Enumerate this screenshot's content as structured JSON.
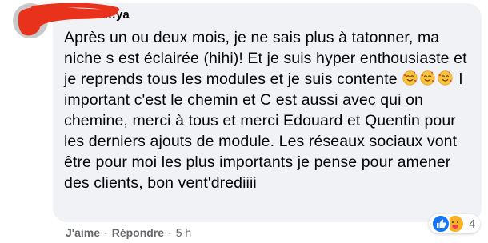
{
  "comment": {
    "author": "…ya",
    "text_before_emoji": "Après un ou deux mois, je ne sais plus à tatonner, ma niche s est éclairée (hihi)! Et je suis hyper enthousiaste et je reprends tous les modules et je suis contente ",
    "emojis": [
      "face-with-hearts-emoji",
      "face-with-hearts-emoji",
      "face-with-hearts-emoji"
    ],
    "text_after_emoji": " l important c'est le chemin et C est aussi avec qui on chemine, merci à tous et merci Edouard et Quentin pour les derniers ajouts de module. Les réseaux sociaux vont être pour moi les plus importants je pense pour amener des clients, bon vent'drediiii"
  },
  "reactions": {
    "icons": [
      "like-icon",
      "care-icon"
    ],
    "count": "4"
  },
  "actions": {
    "like": "J'aime",
    "reply": "Répondre",
    "separator": "·",
    "time": "5 h"
  },
  "colors": {
    "bubble": "#f0f2f5",
    "text": "#050505",
    "meta": "#65676b",
    "like_blue": "#1877f2",
    "care_yellow": "#f7b125",
    "redaction_red": "#e8321c"
  }
}
